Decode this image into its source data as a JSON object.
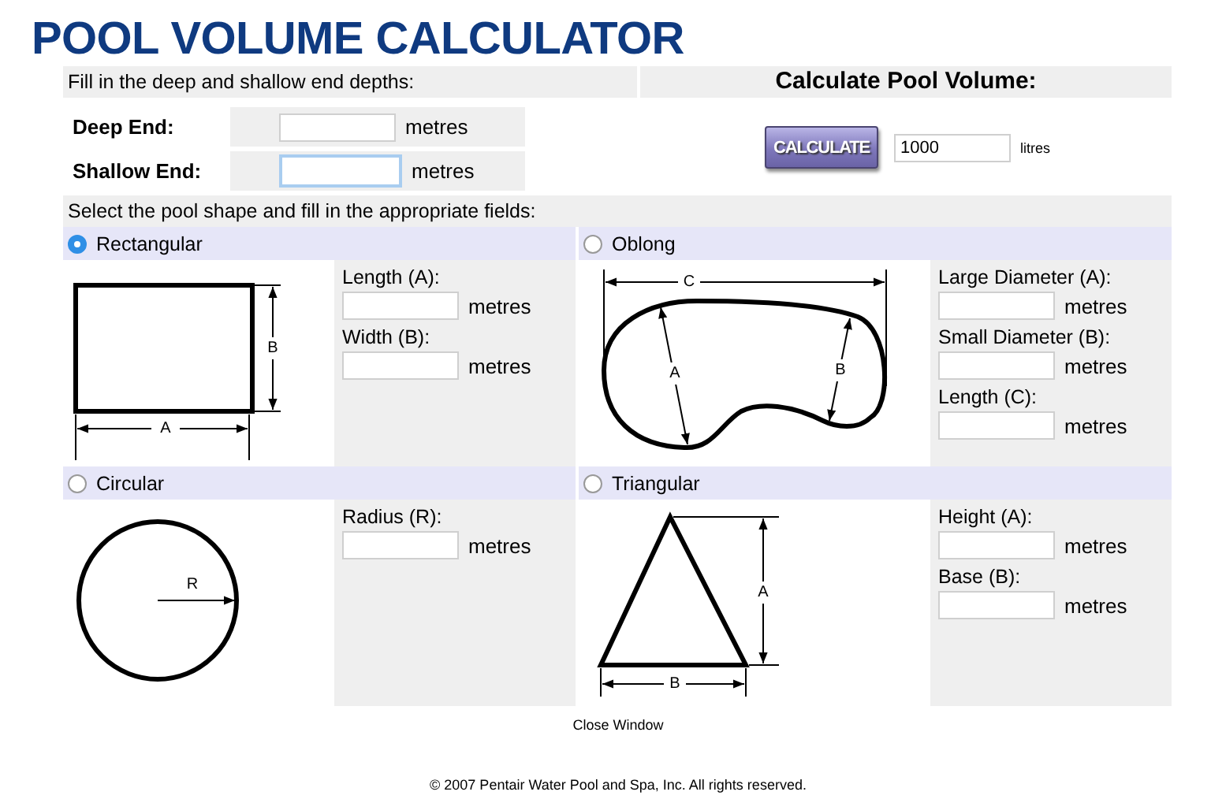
{
  "title": "POOL VOLUME CALCULATOR",
  "depths": {
    "intro": "Fill in the deep and shallow end depths:",
    "fields": [
      {
        "label": "Deep End:",
        "unit": "metres",
        "focused": false
      },
      {
        "label": "Shallow End:",
        "unit": "metres",
        "focused": true
      }
    ]
  },
  "calculate": {
    "heading": "Calculate Pool Volume:",
    "button": "CALCULATE",
    "result": "1000",
    "unit": "litres"
  },
  "shape_prompt": "Select the pool shape and fill in the appropriate fields:",
  "shapes": [
    {
      "kind": "rectangle",
      "label": "Rectangular",
      "selected": true,
      "diagram_labels": [
        "B",
        "A"
      ],
      "fields": [
        {
          "label": "Length (A):",
          "unit": "metres"
        },
        {
          "label": "Width (B):",
          "unit": "metres"
        }
      ]
    },
    {
      "kind": "oblong",
      "label": "Oblong",
      "selected": false,
      "diagram_labels": [
        "C",
        "A",
        "B"
      ],
      "fields": [
        {
          "label": "Large Diameter (A):",
          "unit": "metres"
        },
        {
          "label": "Small Diameter (B):",
          "unit": "metres"
        },
        {
          "label": "Length (C):",
          "unit": "metres"
        }
      ]
    },
    {
      "kind": "circle",
      "label": "Circular",
      "selected": false,
      "diagram_labels": [
        "R"
      ],
      "fields": [
        {
          "label": "Radius (R):",
          "unit": "metres"
        }
      ]
    },
    {
      "kind": "triangle",
      "label": "Triangular",
      "selected": false,
      "diagram_labels": [
        "A",
        "B"
      ],
      "fields": [
        {
          "label": "Height (A):",
          "unit": "metres"
        },
        {
          "label": "Base (B):",
          "unit": "metres"
        }
      ]
    }
  ],
  "close_link": "Close Window",
  "footer": "© 2007 Pentair Water Pool and Spa, Inc. All rights reserved."
}
